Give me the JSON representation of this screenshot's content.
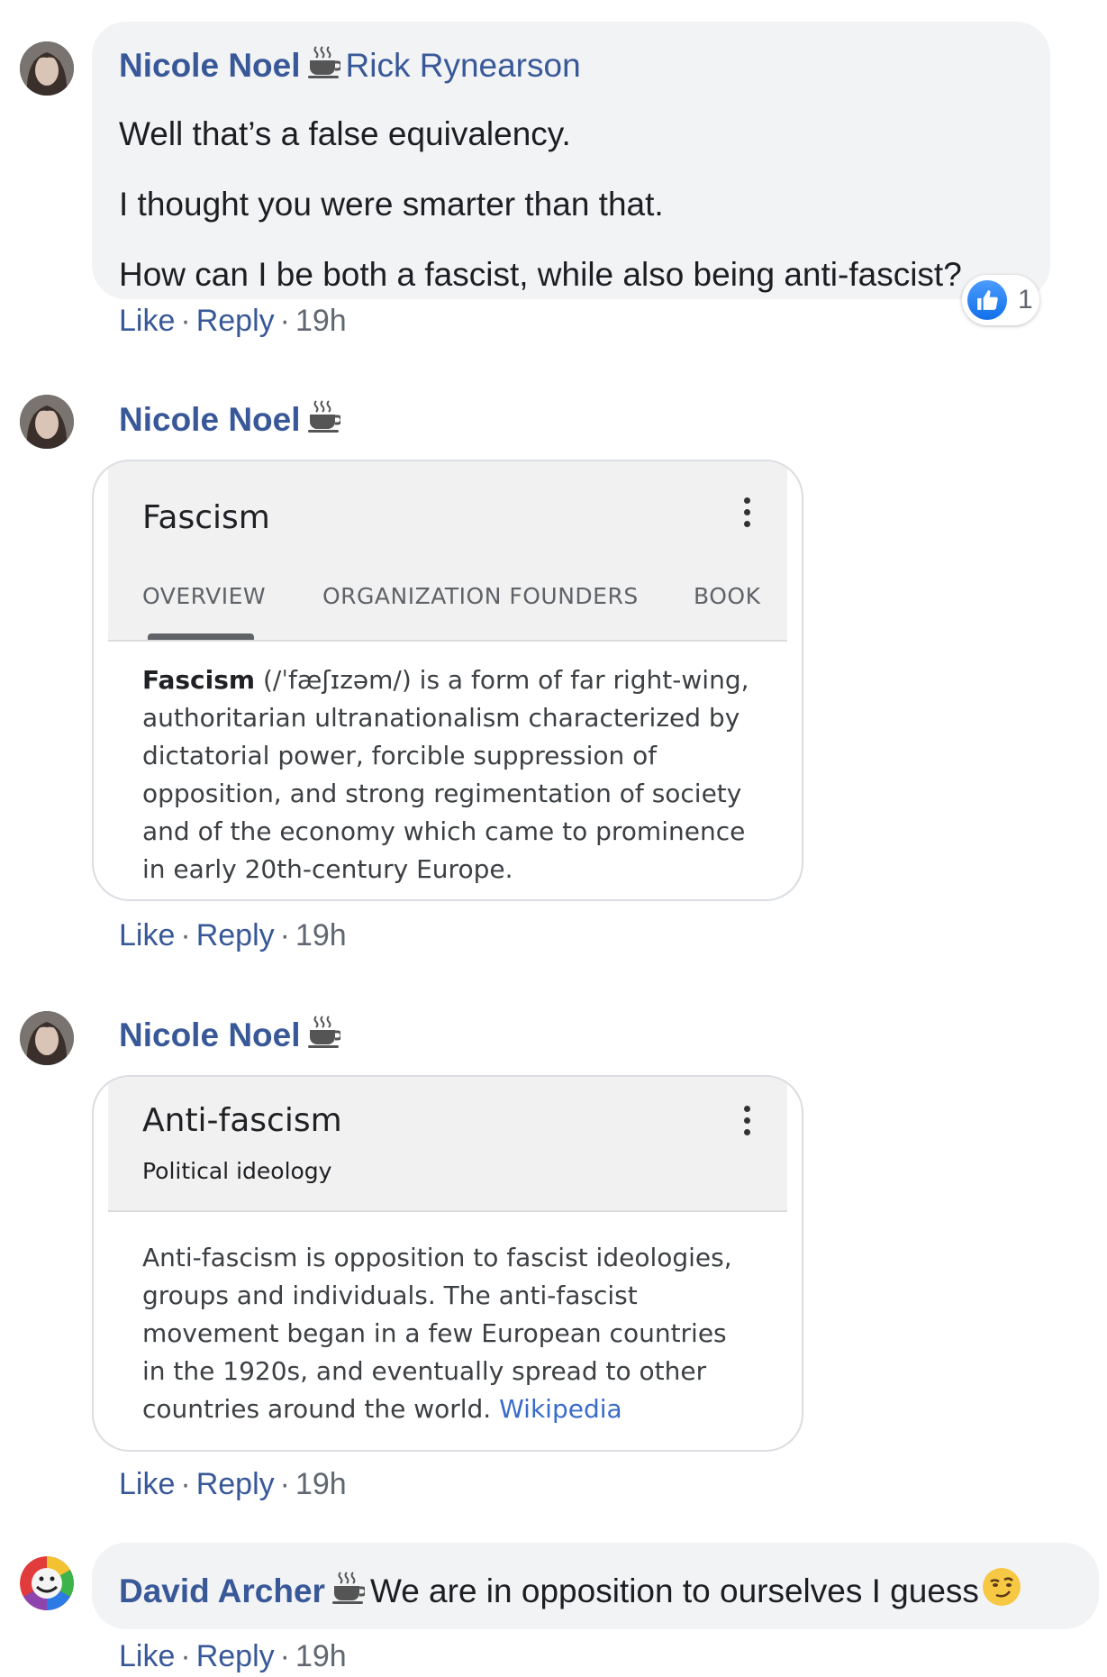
{
  "comments": [
    {
      "author": "Nicole Noel",
      "reply_to": "Rick Rynearson",
      "lines": [
        "Well that’s a false equivalency.",
        "I thought you were smarter than that.",
        "How can I be both a fascist, while also being anti-fascist?"
      ],
      "reaction_count": "1",
      "actions": {
        "like": "Like",
        "reply": "Reply",
        "time": "19h"
      }
    },
    {
      "author": "Nicole Noel",
      "card": {
        "title": "Fascism",
        "tabs": [
          "OVERVIEW",
          "ORGANIZATION FOUNDERS",
          "BOOK"
        ],
        "body_bold": "Fascism",
        "body_text": " (/ˈfæʃɪzəm/) is a form of far right-wing, authoritarian ultranationalism characterized by dictatorial power, forcible suppression of opposition, and strong regimentation of society and of the economy which came to prominence in early 20th-century Europe."
      },
      "actions": {
        "like": "Like",
        "reply": "Reply",
        "time": "19h"
      }
    },
    {
      "author": "Nicole Noel",
      "card": {
        "title": "Anti-fascism",
        "subtitle": "Political ideology",
        "body_text": "Anti-fascism is opposition to fascist ideologies, groups and individuals. The anti-fascist movement began in a few European countries in the 1920s, and eventually spread to other countries around the world. ",
        "link": "Wikipedia"
      },
      "actions": {
        "like": "Like",
        "reply": "Reply",
        "time": "19h"
      }
    },
    {
      "author": "David Archer",
      "text": "We are in opposition to ourselves I guess",
      "emoji": "smirk-emoji",
      "actions": {
        "like": "Like",
        "reply": "Reply",
        "time": "19h"
      }
    }
  ],
  "separator": "·",
  "colors": {
    "name": "#385898",
    "bubble": "#f2f3f5",
    "meta": "#606770",
    "like": "#1877f2"
  }
}
